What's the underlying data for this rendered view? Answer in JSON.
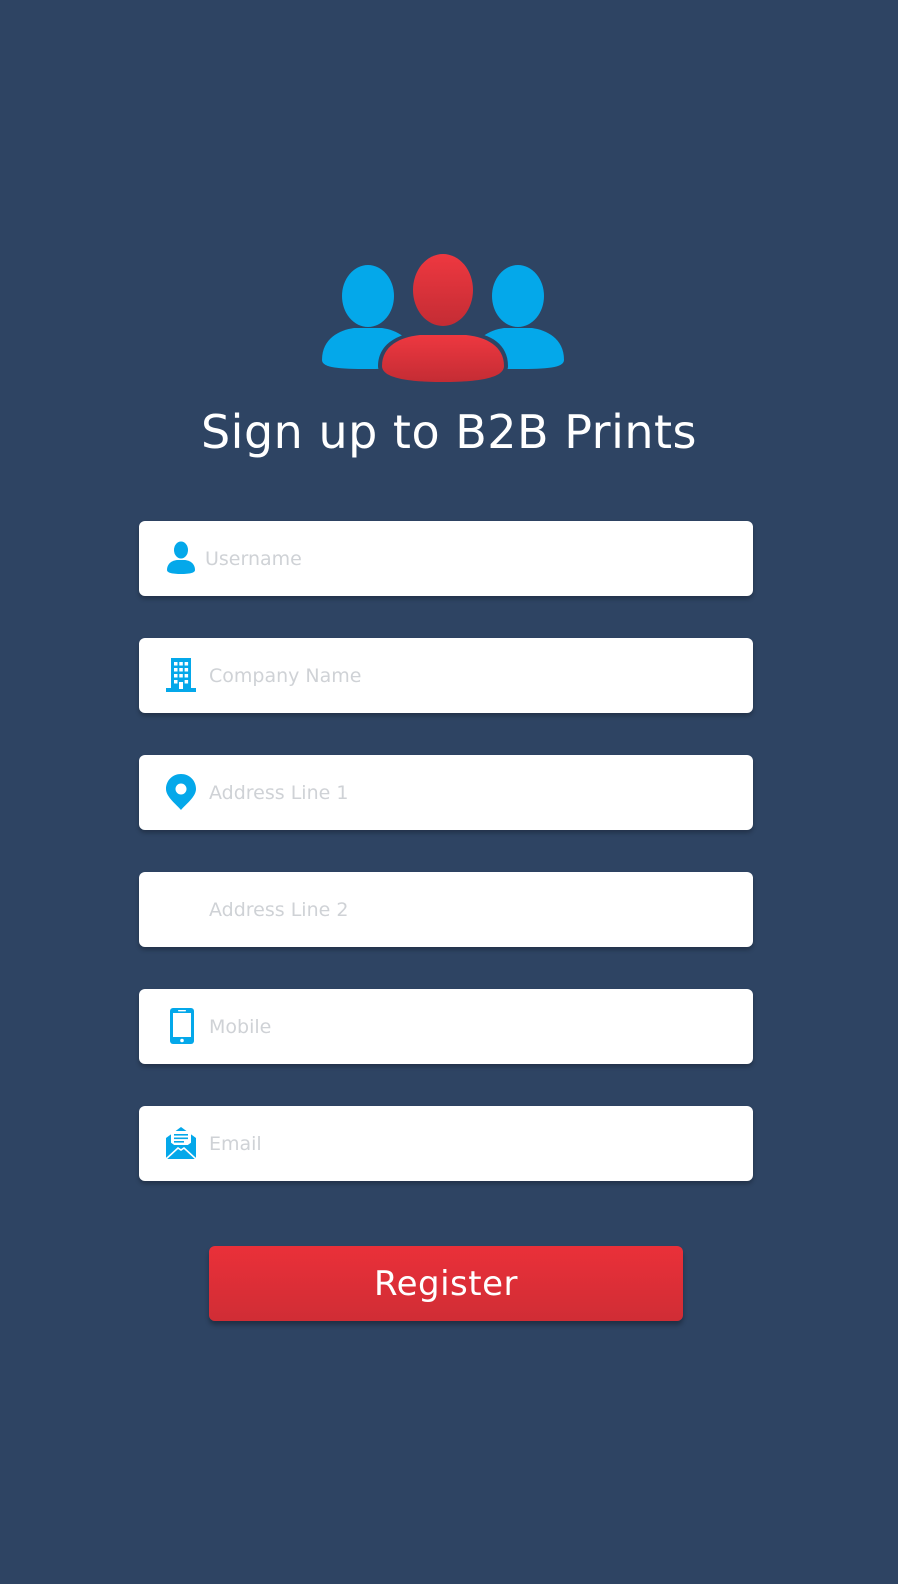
{
  "header": {
    "logo_icon": "group-users-icon",
    "title": "Sign up to B2B Prints"
  },
  "form": {
    "fields": [
      {
        "icon": "user-icon",
        "placeholder": "Username",
        "value": ""
      },
      {
        "icon": "building-icon",
        "placeholder": "Company Name",
        "value": ""
      },
      {
        "icon": "map-pin-icon",
        "placeholder": "Address Line 1",
        "value": ""
      },
      {
        "icon": "",
        "placeholder": "Address Line 2",
        "value": ""
      },
      {
        "icon": "mobile-phone-icon",
        "placeholder": "Mobile",
        "value": ""
      },
      {
        "icon": "envelope-open-icon",
        "placeholder": "Email",
        "value": ""
      }
    ],
    "submit_label": "Register"
  },
  "colors": {
    "background": "#2e4463",
    "accent_blue": "#04a8ea",
    "accent_red": "#e8323b",
    "field_background": "#ffffff",
    "placeholder": "#cfd2d6"
  }
}
